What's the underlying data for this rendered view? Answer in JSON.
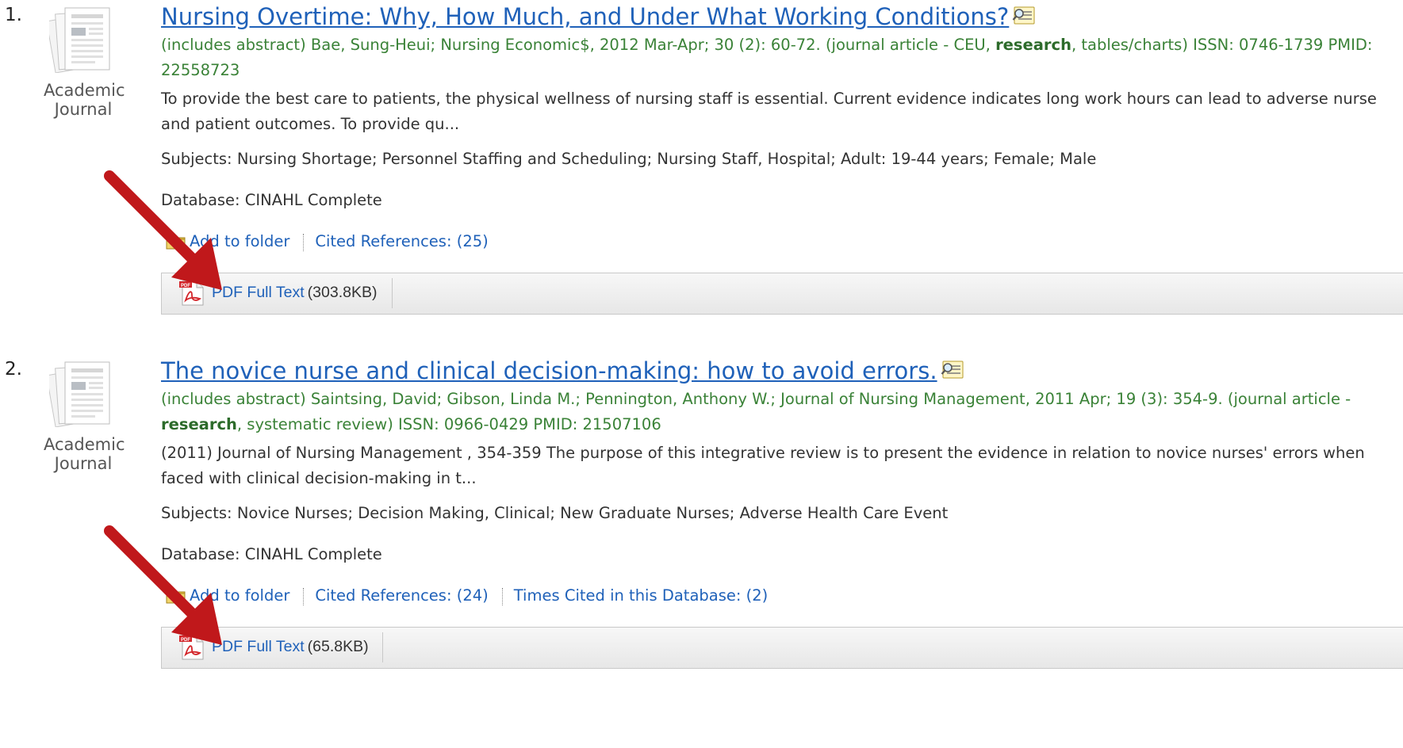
{
  "results": [
    {
      "number": "1.",
      "type_line1": "Academic",
      "type_line2": "Journal",
      "title": "Nursing Overtime: Why, How Much, and Under What Working Conditions?",
      "cite_pre": "(includes abstract) Bae, Sung-Heui; Nursing Economic$, 2012 Mar-Apr; 30 (2): 60-72. (journal article - CEU, ",
      "cite_bold": "research",
      "cite_post": ", tables/charts) ISSN: 0746-1739 PMID: 22558723",
      "abstract": "To provide the best care to patients, the physical wellness of nursing staff is essential. Current evidence indicates long work hours can lead to adverse nurse and patient outcomes. To provide qu...",
      "subjects": "Subjects: Nursing Shortage; Personnel Staffing and Scheduling; Nursing Staff, Hospital; Adult: 19-44 years; Female; Male",
      "database": "Database: CINAHL Complete",
      "add_to_folder": "Add to folder",
      "cited_references": "Cited References: (25)",
      "pdf_label": "PDF Full Text",
      "pdf_size": "(303.8KB)"
    },
    {
      "number": "2.",
      "type_line1": "Academic",
      "type_line2": "Journal",
      "title": "The novice nurse and clinical decision-making: how to avoid errors.",
      "cite_pre": "(includes abstract) Saintsing, David; Gibson, Linda M.; Pennington, Anthony W.; Journal of Nursing Management, 2011 Apr; 19 (3): 354-9. (journal article - ",
      "cite_bold": "research",
      "cite_post": ", systematic review) ISSN: 0966-0429 PMID: 21507106",
      "abstract": "(2011) Journal of Nursing Management , 354-359 The purpose of this integrative review is to present the evidence in relation to novice nurses' errors when faced with clinical decision-making in t...",
      "subjects": "Subjects: Novice Nurses; Decision Making, Clinical; New Graduate Nurses; Adverse Health Care Event",
      "database": "Database: CINAHL Complete",
      "add_to_folder": "Add to folder",
      "cited_references": "Cited References: (24)",
      "times_cited": "Times Cited in this Database: (2)",
      "pdf_label": "PDF Full Text",
      "pdf_size": "(65.8KB)"
    }
  ],
  "colors": {
    "link": "#1f61b9",
    "citation": "#3a8237",
    "annotation_arrow": "#c0181b"
  },
  "icons": [
    "document-thumbnail-icon",
    "preview-magnifier-icon",
    "folder-icon",
    "pdf-icon"
  ]
}
